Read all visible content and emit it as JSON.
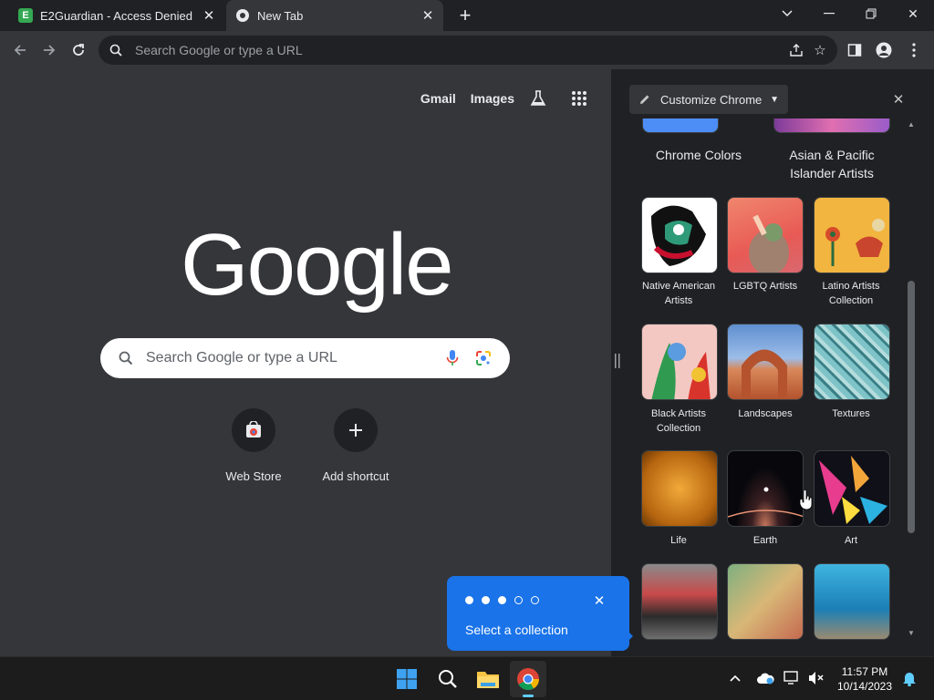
{
  "tabs": [
    {
      "title": "E2Guardian - Access Denied",
      "favicon_letter": "E",
      "favicon_color": "#34a853"
    },
    {
      "title": "New Tab"
    }
  ],
  "omnibox": {
    "placeholder": "Search Google or type a URL"
  },
  "ntp": {
    "links": [
      "Gmail",
      "Images"
    ],
    "logo": "Google",
    "search_placeholder": "Search Google or type a URL",
    "shortcuts": [
      {
        "label": "Web Store"
      },
      {
        "label": "Add shortcut"
      }
    ]
  },
  "panel": {
    "header": "Customize Chrome",
    "top_row": [
      "Chrome Colors",
      "Asian & Pacific Islander Artists"
    ],
    "collections": [
      {
        "label": "Native American Artists"
      },
      {
        "label": "LGBTQ Artists"
      },
      {
        "label": "Latino Artists Collection"
      },
      {
        "label": "Black Artists Collection"
      },
      {
        "label": "Landscapes"
      },
      {
        "label": "Textures"
      },
      {
        "label": "Life"
      },
      {
        "label": "Earth"
      },
      {
        "label": "Art"
      }
    ]
  },
  "tooltip": {
    "text": "Select a collection",
    "steps_total": 5,
    "steps_done": 3
  },
  "taskbar": {
    "time": "11:57 PM",
    "date": "10/14/2023"
  },
  "colors": {
    "accent": "#1a73e8",
    "toolbar": "#35363a",
    "frame": "#202124"
  }
}
